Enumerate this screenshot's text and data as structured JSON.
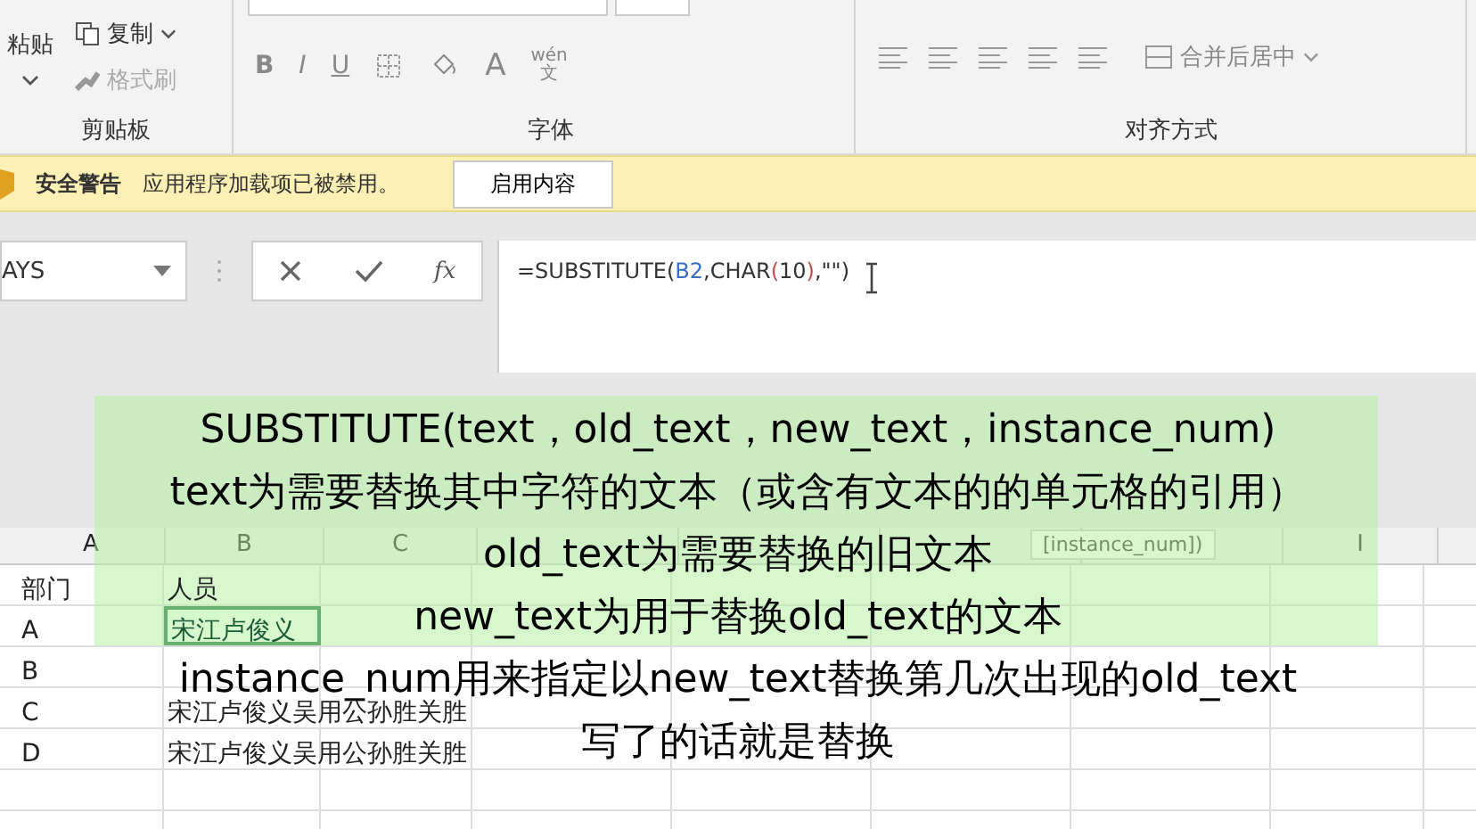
{
  "ribbon": {
    "clipboard": {
      "paste": "粘贴",
      "copy": "复制",
      "format_painter": {
        "label": "格式刷",
        "disabled": true
      },
      "label": "剪贴板"
    },
    "font": {
      "buttons": [
        "B",
        "I",
        "U"
      ],
      "font_color": "A",
      "phonetic": {
        "top": "wén",
        "bottom": "文"
      },
      "label": "字体"
    },
    "alignment": {
      "merge": "合并后居中",
      "label": "对齐方式"
    }
  },
  "security_bar": {
    "title": "安全警告",
    "message": "应用程序加载项已被禁用。",
    "button": "启用内容"
  },
  "formula_bar": {
    "name_box": "AYS",
    "fx": "fx",
    "formula": [
      {
        "text": "=SUBSTITUTE(",
        "color": "#333333"
      },
      {
        "text": "B2",
        "color": "#3a6fc4"
      },
      {
        "text": ",CHAR",
        "color": "#333333"
      },
      {
        "text": "(",
        "color": "#c0504d"
      },
      {
        "text": "10",
        "color": "#333333"
      },
      {
        "text": ")",
        "color": "#c0504d"
      },
      {
        "text": ",\"\")",
        "color": "#333333"
      }
    ]
  },
  "sheet": {
    "columns": [
      {
        "label": "A"
      },
      {
        "label": "B"
      },
      {
        "label": "C"
      },
      {},
      {},
      {},
      {},
      {
        "label": "I"
      },
      {}
    ],
    "tooltip": "[instance_num])",
    "rows": [
      {
        "cells": [
          "部门",
          "人员"
        ],
        "selected": false
      },
      {
        "cells": [
          "A",
          "宋江卢俊义"
        ],
        "selected": true
      },
      {
        "cells": [
          "B"
        ],
        "selected": false
      },
      {
        "cells": [
          "C",
          "宋江卢俊义吴用公孙胜关胜"
        ],
        "selected": false
      },
      {
        "cells": [
          "D",
          "宋江卢俊义吴用公孙胜关胜"
        ],
        "selected": false
      }
    ]
  },
  "subtitles": [
    "SUBSTITUTE(text，old_text，new_text，instance_num)",
    "text为需要替换其中字符的文本（或含有文本的的单元格的引用）",
    "old_text为需要替换的旧文本",
    "new_text为用于替换old_text的文本",
    "instance_num用来指定以new_text替换第几次出现的old_text",
    "写了的话就是替换"
  ]
}
